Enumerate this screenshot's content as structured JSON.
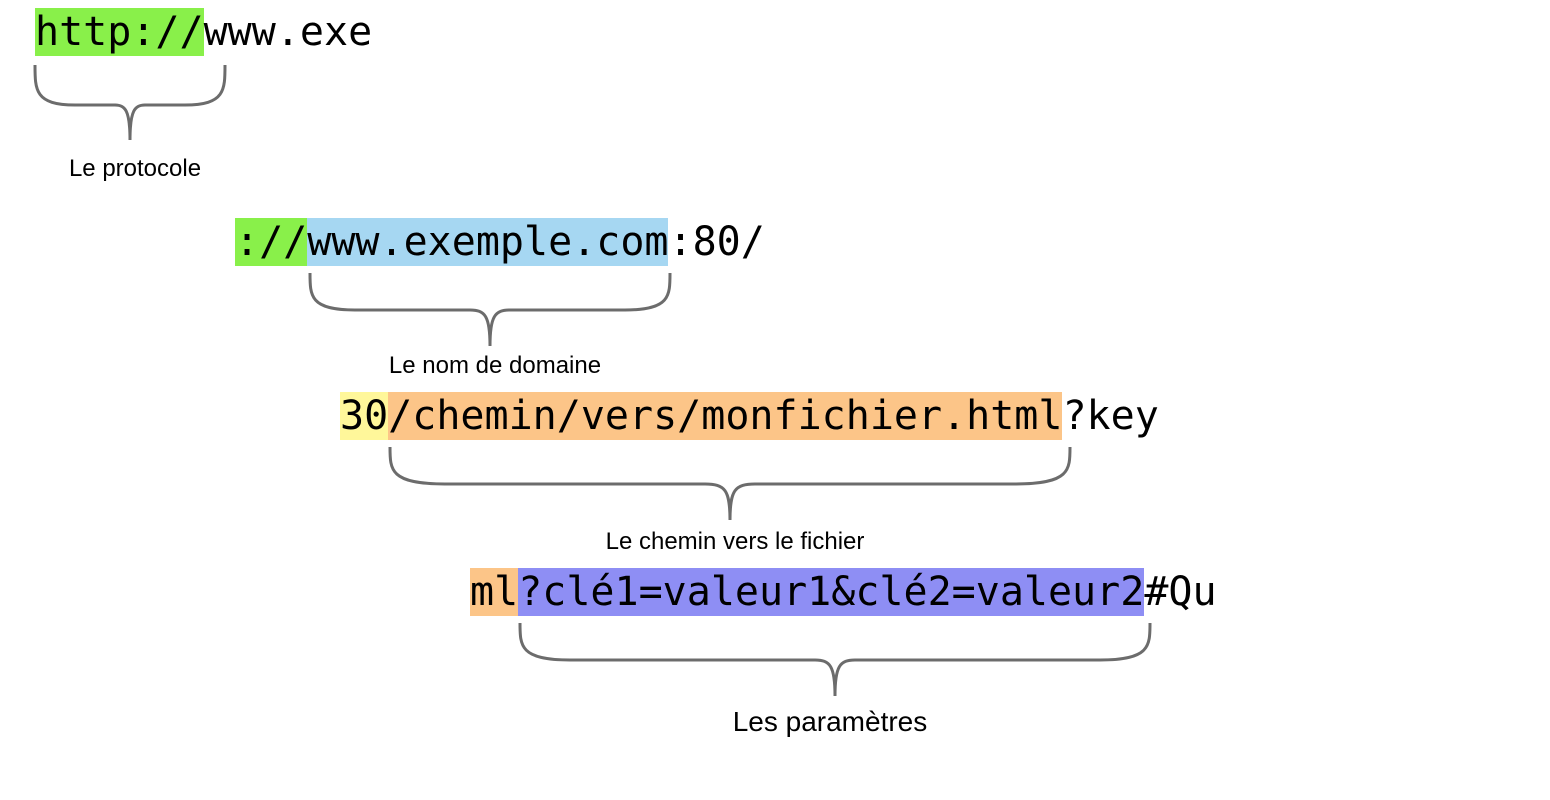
{
  "rows": {
    "r1": {
      "segA_text": "http://",
      "segB_text": "www.exe"
    },
    "r2": {
      "segA_text": "://",
      "segB_text": "www.exemple.com",
      "segC_text": ":80/"
    },
    "r3": {
      "segA_text": "30",
      "segB_text": "/chemin/vers/monfichier.html",
      "segC_text": "?key"
    },
    "r4": {
      "segA_text": "ml",
      "segB_text": "?clé1=valeur1&clé2=valeur2",
      "segC_text": "#Qu"
    }
  },
  "captions": {
    "protocol": "Le protocole",
    "domain": "Le nom de domaine",
    "path": "Le chemin vers le fichier",
    "params": "Les paramètres"
  },
  "colors": {
    "green": "#89f04a",
    "blue": "#a6d7f2",
    "yellow": "#fff79a",
    "orange": "#fcc588",
    "purple": "#8e8ef4",
    "bracket": "#6c6c6c"
  }
}
